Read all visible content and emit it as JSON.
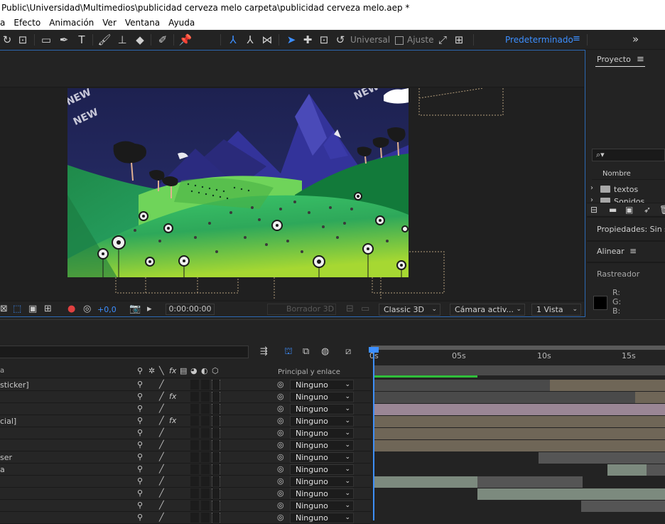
{
  "window": {
    "title": "Public\\Universidad\\Multimedios\\publicidad cerveza melo carpeta\\publicidad cerveza melo.aep *"
  },
  "menu": [
    "a",
    "Efecto",
    "Animación",
    "Ver",
    "Ventana",
    "Ayuda"
  ],
  "toolbar": {
    "axis_mode": "Universal",
    "snap_label": "Ajuste",
    "workspace": "Predeterminado",
    "workspace_menu_icon": "≡",
    "expand_icon": "»"
  },
  "composition": {
    "overlay_text_1": "NEW",
    "overlay_text_2": "NEW",
    "overlay_text_3": "NEW",
    "footer": {
      "exposure": "+0,0",
      "timecode": "0:00:00:00",
      "draft": "Borrador 3D",
      "renderer": "Classic 3D",
      "camera": "Cámara activ...",
      "views": "1 Vista"
    }
  },
  "right_panels": {
    "project": {
      "title": "Proyecto",
      "search_icon": "🔍",
      "column_name": "Nombre",
      "items": [
        "textos",
        "Sonidos"
      ]
    },
    "properties": {
      "title": "Propiedades: Sin se"
    },
    "align": {
      "title": "Alinear",
      "menu_icon": "≡"
    },
    "tracker": {
      "title": "Rastreador",
      "r": "R:",
      "g": "G:",
      "b": "B:"
    }
  },
  "timeline": {
    "column_parent": "Principal y enlace",
    "column_name_stub": "a",
    "ruler_ticks": [
      "0s",
      "05s",
      "10s",
      "15s"
    ],
    "rows": [
      {
        "name": "sticker]",
        "fx": false,
        "parent": "Ninguno"
      },
      {
        "name": "",
        "fx": true,
        "parent": "Ninguno"
      },
      {
        "name": "",
        "fx": false,
        "parent": "Ninguno"
      },
      {
        "name": "cial]",
        "fx": true,
        "parent": "Ninguno"
      },
      {
        "name": "",
        "fx": false,
        "parent": "Ninguno"
      },
      {
        "name": "",
        "fx": false,
        "parent": "Ninguno"
      },
      {
        "name": "ser",
        "fx": false,
        "parent": "Ninguno"
      },
      {
        "name": "a",
        "fx": false,
        "parent": "Ninguno"
      },
      {
        "name": "",
        "fx": false,
        "parent": "Ninguno"
      },
      {
        "name": "",
        "fx": false,
        "parent": "Ninguno"
      },
      {
        "name": "",
        "fx": false,
        "parent": "Ninguno"
      },
      {
        "name": "",
        "fx": false,
        "parent": "Ninguno"
      }
    ]
  },
  "colors": {
    "accent": "#3d8fff",
    "panel_bg": "#232323",
    "bar_tan": "#6f6657",
    "bar_pink": "#9a8695",
    "bar_sage": "#7c8a7e"
  }
}
